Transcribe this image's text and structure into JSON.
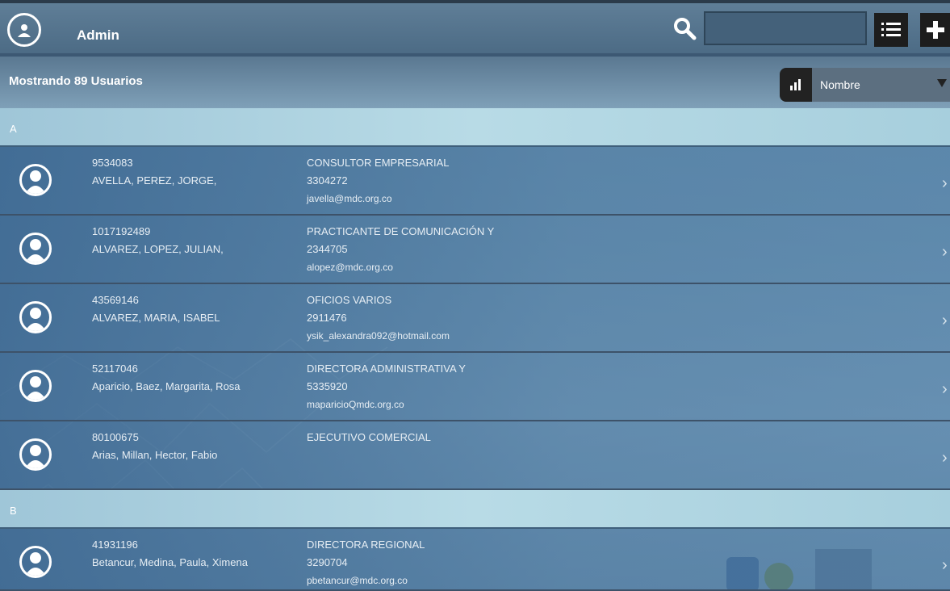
{
  "header": {
    "title": "Admin",
    "search_placeholder": "",
    "icons": {
      "user": "user-avatar-icon",
      "search": "search-icon",
      "list": "list-icon",
      "add": "plus-icon"
    }
  },
  "count_label": "Mostrando 89 Usuarios",
  "sort": {
    "selected": "Nombre",
    "icon": "bar-chart-icon"
  },
  "colors": {
    "topbar": "#4f6f89",
    "group_header": "#aed3e0",
    "row": "#4f7ca5",
    "dark_button": "#1d1d1d"
  },
  "groups": [
    {
      "letter": "A",
      "users": [
        {
          "id": "9534083",
          "name": "AVELLA, PEREZ, JORGE,",
          "job": "CONSULTOR EMPRESARIAL",
          "phone": "3304272",
          "email": "javella@mdc.org.co"
        },
        {
          "id": "1017192489",
          "name": "ALVAREZ, LOPEZ, JULIAN,",
          "job": "PRACTICANTE DE COMUNICACIÓN Y",
          "phone": "2344705",
          "email": "alopez@mdc.org.co"
        },
        {
          "id": "43569146",
          "name": "ALVAREZ, MARIA, ISABEL",
          "job": "OFICIOS VARIOS",
          "phone": "2911476",
          "email": "ysik_alexandra092@hotmail.com"
        },
        {
          "id": "52117046",
          "name": "Aparicio, Baez, Margarita, Rosa",
          "job": "DIRECTORA ADMINISTRATIVA Y",
          "phone": "5335920",
          "email": "maparicioQmdc.org.co"
        },
        {
          "id": "80100675",
          "name": "Arias, Millan, Hector, Fabio",
          "job": "EJECUTIVO COMERCIAL",
          "phone": "",
          "email": ""
        }
      ]
    },
    {
      "letter": "B",
      "users": [
        {
          "id": "41931196",
          "name": "Betancur, Medina, Paula, Ximena",
          "job": "DIRECTORA REGIONAL",
          "phone": "3290704",
          "email": "pbetancur@mdc.org.co"
        }
      ]
    }
  ]
}
